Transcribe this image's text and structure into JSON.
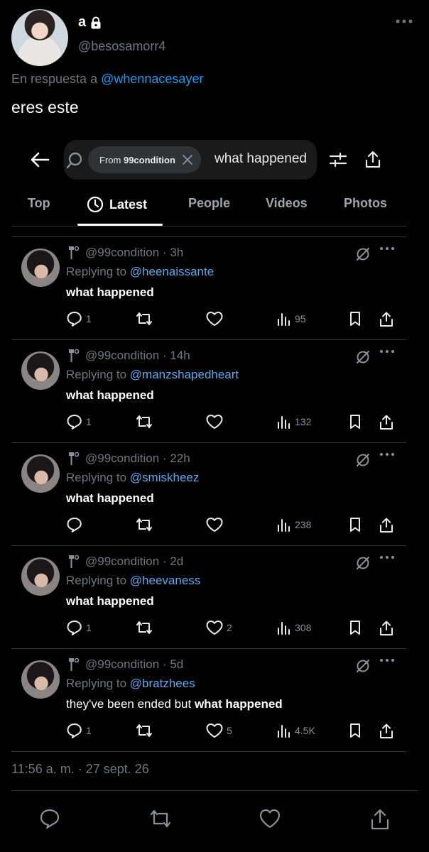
{
  "author": {
    "name": "a",
    "handle": "@besosamorr4",
    "verified_lock": "lock-icon"
  },
  "reply_prefix": "En respuesta a",
  "reply_handle": "@whennacesayer",
  "tweet_text": "eres este",
  "embedded": {
    "search": {
      "chip_prefix": "From",
      "chip_user": "99condition",
      "query": "what happened"
    },
    "tabs": [
      {
        "label": "Top"
      },
      {
        "label": "Latest",
        "active": true
      },
      {
        "label": "People"
      },
      {
        "label": "Videos"
      },
      {
        "label": "Photos"
      }
    ],
    "results": [
      {
        "meta": "@99condition · 3h",
        "replying_prefix": "Replying to",
        "replying_handle": "@heenaissante",
        "text_plain": "",
        "text_bold": "what happened",
        "replies": "1",
        "retweets": "",
        "likes": "",
        "views": "95"
      },
      {
        "meta": "@99condition · 14h",
        "replying_prefix": "Replying to",
        "replying_handle": "@manzshapedheart",
        "text_plain": "",
        "text_bold": "what happened",
        "replies": "1",
        "retweets": "",
        "likes": "",
        "views": "132"
      },
      {
        "meta": "@99condition · 22h",
        "replying_prefix": "Replying to",
        "replying_handle": "@smiskheez",
        "text_plain": "",
        "text_bold": "what happened",
        "replies": "",
        "retweets": "",
        "likes": "",
        "views": "238"
      },
      {
        "meta": "@99condition · 2d",
        "replying_prefix": "Replying to",
        "replying_handle": "@heevaness",
        "text_plain": "",
        "text_bold": "what happened",
        "replies": "1",
        "retweets": "",
        "likes": "2",
        "views": "308"
      },
      {
        "meta": "@99condition · 5d",
        "replying_prefix": "Replying to",
        "replying_handle": "@bratzhees",
        "text_plain": "they've been ended but ",
        "text_bold": "what happened",
        "replies": "1",
        "retweets": "",
        "likes": "5",
        "views": "4.5K"
      }
    ]
  },
  "timestamp": "11:56 a. m. · 27 sept. 26",
  "colors": {
    "accent": "#1d9bf0",
    "background": "#000000",
    "muted": "#71767b"
  }
}
